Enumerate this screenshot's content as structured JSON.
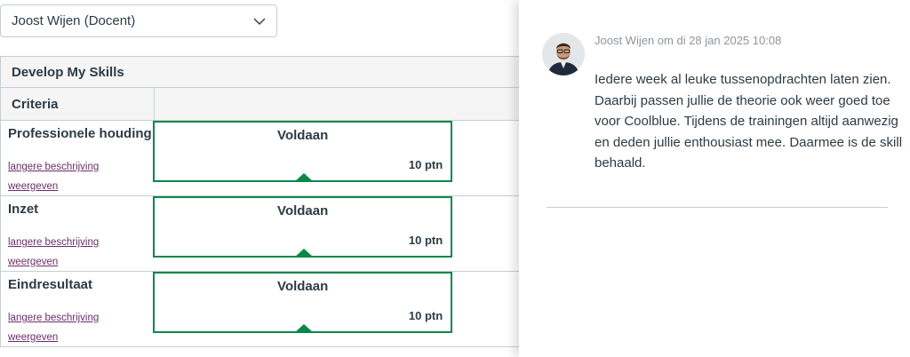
{
  "grader": {
    "selected": "Joost Wijen (Docent)"
  },
  "rubric": {
    "title": "Develop My Skills",
    "criteria_header": "Criteria",
    "rows": [
      {
        "name": "Professionele houding",
        "link_line1": "langere beschrijving",
        "link_line2": "weergeven",
        "rating": "Voldaan",
        "points": "10 ptn"
      },
      {
        "name": "Inzet",
        "link_line1": "langere beschrijving",
        "link_line2": "weergeven",
        "rating": "Voldaan",
        "points": "10 ptn"
      },
      {
        "name": "Eindresultaat",
        "link_line1": "langere beschrijving",
        "link_line2": "weergeven",
        "rating": "Voldaan",
        "points": "10 ptn"
      }
    ]
  },
  "comment": {
    "author_meta": "Joost Wijen om di 28 jan 2025 10:08",
    "text": "Iedere week al leuke tussenopdrachten laten zien.\nDaarbij passen jullie de theorie ook weer goed toe\nvoor Coolblue. Tijdens de trainingen altijd aanwezig\nen deden jullie enthousiast mee. Daarmee is de skill\nbehaald."
  },
  "colors": {
    "selected_rating": "#0b874b",
    "link": "#6b2e6b",
    "border": "#c7cdd1"
  }
}
